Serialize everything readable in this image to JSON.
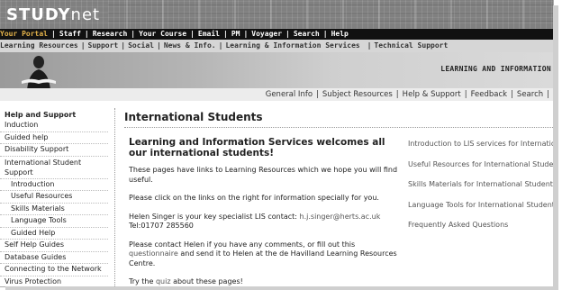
{
  "logo": {
    "bold": "STUDY",
    "rest": "net"
  },
  "nav_primary": {
    "items": [
      {
        "label": "Your Portal",
        "active": true
      },
      {
        "label": "Staff"
      },
      {
        "label": "Research"
      },
      {
        "label": "Your Course"
      },
      {
        "label": "Email"
      },
      {
        "label": "PM"
      },
      {
        "label": "Voyager"
      },
      {
        "label": "Search"
      },
      {
        "label": "Help"
      }
    ]
  },
  "nav_secondary": {
    "items": [
      {
        "label": "Learning Resources"
      },
      {
        "label": "Support"
      },
      {
        "label": "Social"
      },
      {
        "label": "News & Info."
      },
      {
        "label": "Learning & Information Services"
      },
      {
        "label": "Technical Support"
      }
    ]
  },
  "banner": {
    "title": "LEARNING AND INFORMATION"
  },
  "subnav": {
    "items": [
      {
        "label": "General Info"
      },
      {
        "label": "Subject Resources"
      },
      {
        "label": "Help & Support"
      },
      {
        "label": "Feedback"
      },
      {
        "label": "Search"
      }
    ]
  },
  "sidebar": {
    "heading": "Help and Support",
    "items": [
      {
        "label": "Induction"
      },
      {
        "label": "Guided help"
      },
      {
        "label": "Disability Support"
      },
      {
        "label": "International Student Support"
      },
      {
        "label": "Introduction",
        "sub": true
      },
      {
        "label": "Useful Resources",
        "sub": true
      },
      {
        "label": "Skills Materials",
        "sub": true
      },
      {
        "label": "Language Tools",
        "sub": true
      },
      {
        "label": "Guided Help",
        "sub": true
      },
      {
        "label": "Self Help Guides"
      },
      {
        "label": "Database Guides"
      },
      {
        "label": "Connecting to the Network"
      },
      {
        "label": "Virus Protection"
      }
    ]
  },
  "main": {
    "title": "International Students",
    "heading": "Learning and Information Services welcomes all our international students!",
    "p1": "These pages have links to Learning Resources which we hope you will find useful.",
    "p2": "Please click on the links on the right for information specially for you.",
    "p3_prefix": "Helen Singer is your key specialist LIS contact: ",
    "p3_email": "h.j.singer@herts.ac.uk",
    "p3_tel": " Tel:01707 285560",
    "p4_prefix": "Please contact Helen if you have any comments, or fill out this ",
    "p4_link": "questionnaire",
    "p4_suffix": " and send it to Helen at the de Havilland Learning Resources Centre.",
    "p5_prefix": "Try the ",
    "p5_link": "quiz",
    "p5_suffix": " about these pages!"
  },
  "right_links": [
    {
      "label": "Introduction to LIS services for International Students"
    },
    {
      "label": "Useful Resources for International Students"
    },
    {
      "label": "Skills Materials for International Students"
    },
    {
      "label": "Language Tools for International Students"
    },
    {
      "label": "Frequently Asked Questions"
    }
  ],
  "colors": {
    "nav_active": "#e3b24a",
    "nav_bg": "#111111",
    "logo_bg": "#808080"
  }
}
